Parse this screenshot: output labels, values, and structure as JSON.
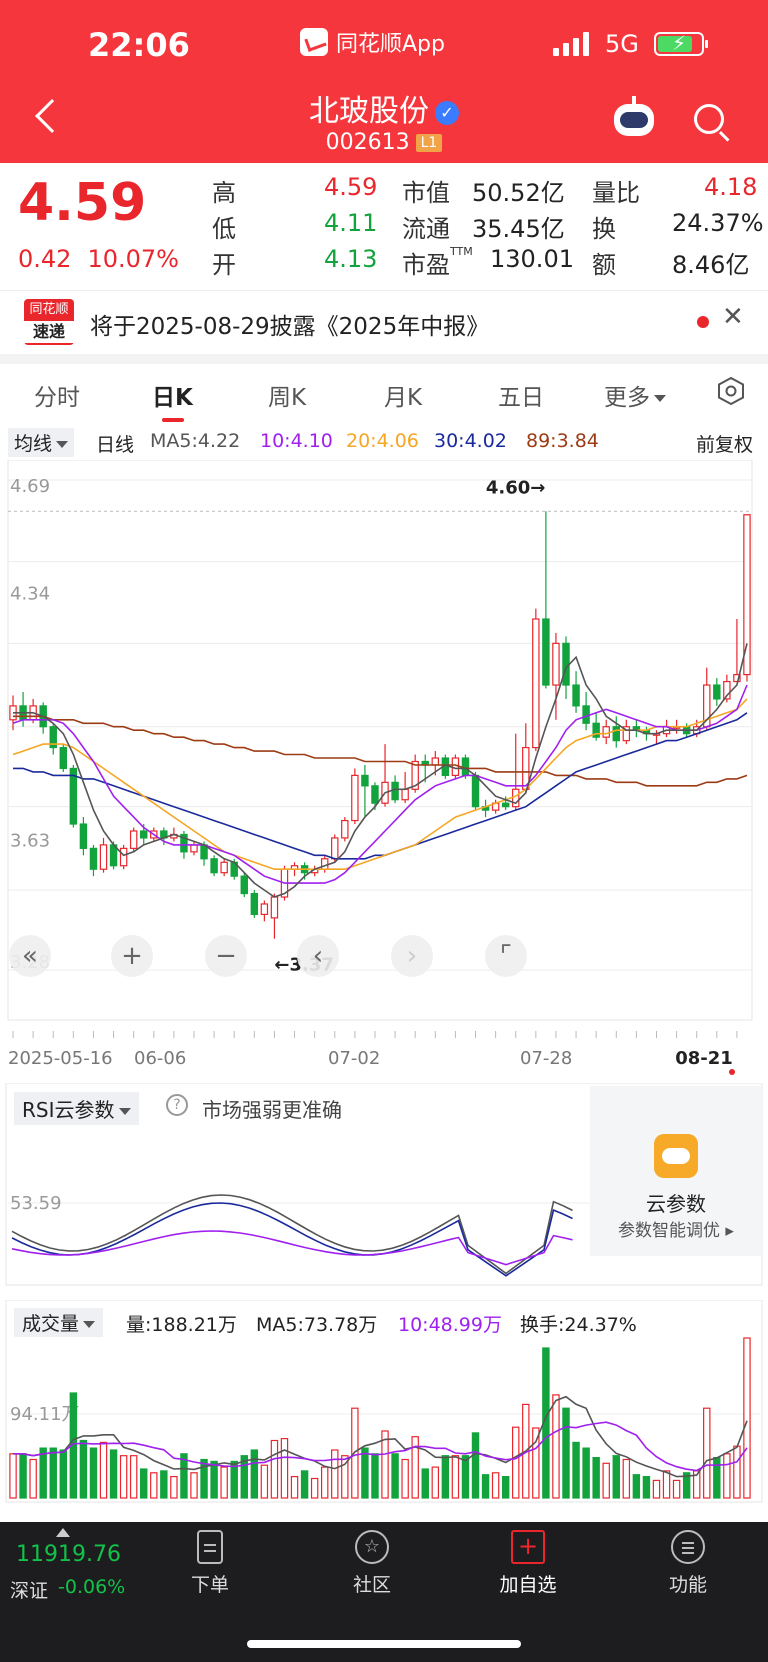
{
  "status": {
    "time": "22:06",
    "app": "同花顺App",
    "network": "5G"
  },
  "header": {
    "name": "北玻股份",
    "verified": "✓",
    "code": "002613",
    "level": "L1"
  },
  "quote": {
    "price": "4.59",
    "change": "0.42",
    "change_pct": "10.07%",
    "rows": [
      {
        "l1": "高",
        "v1": "4.59",
        "l2": "市值",
        "v2": "50.52亿",
        "l3": "量比",
        "v3": "4.18"
      },
      {
        "l1": "低",
        "v1": "4.11",
        "l2": "流通",
        "v2": "35.45亿",
        "l3": "换",
        "v3": "24.37%"
      },
      {
        "l1": "开",
        "v1": "4.13",
        "l2": "市盈",
        "l2_sup": "TTM",
        "v2": "130.01",
        "l3": "额",
        "v3": "8.46亿"
      }
    ]
  },
  "notice": {
    "logo_top": "同花顺",
    "logo_bottom": "速递",
    "text": "将于2025-08-29披露《2025年中报》"
  },
  "tabs": [
    "分时",
    "日K",
    "周K",
    "月K",
    "五日",
    "更多"
  ],
  "legend": {
    "select": "均线",
    "period": "日线",
    "ma5": "MA5:4.22",
    "ma10": "10:4.10",
    "ma20": "20:4.06",
    "ma30": "30:4.02",
    "ma89": "89:3.84",
    "adjust": "前复权"
  },
  "colors": {
    "up": "#e8262c",
    "down": "#12a33d",
    "ma5": "#555555",
    "ma10": "#a020f0",
    "ma20": "#f5a623",
    "ma30": "#1a2a9c",
    "ma89": "#9c3b14"
  },
  "chart": {
    "ytick_labels": [
      "4.69",
      "4.34",
      "3.63",
      "3.28"
    ],
    "max_label": "4.60→",
    "min_label": "←3.37",
    "x_labels": [
      "2025-05-16",
      "06-06",
      "07-02",
      "07-28",
      "08-21"
    ]
  },
  "chart_data": {
    "type": "candlestick",
    "y_ticks": [
      4.69,
      4.34,
      3.63,
      3.28
    ],
    "high_marker": 4.6,
    "low_marker": 3.37,
    "candles": [
      [
        4.0,
        4.04,
        4.07,
        3.97
      ],
      [
        4.04,
        4.0,
        4.08,
        3.98
      ],
      [
        4.0,
        4.04,
        4.06,
        3.99
      ],
      [
        4.04,
        3.98,
        4.05,
        3.96
      ],
      [
        3.98,
        3.92,
        3.99,
        3.9
      ],
      [
        3.92,
        3.86,
        3.93,
        3.85
      ],
      [
        3.86,
        3.7,
        3.87,
        3.69
      ],
      [
        3.7,
        3.63,
        3.72,
        3.61
      ],
      [
        3.63,
        3.57,
        3.64,
        3.55
      ],
      [
        3.57,
        3.64,
        3.66,
        3.56
      ],
      [
        3.64,
        3.58,
        3.65,
        3.57
      ],
      [
        3.58,
        3.63,
        3.64,
        3.57
      ],
      [
        3.63,
        3.68,
        3.69,
        3.62
      ],
      [
        3.68,
        3.66,
        3.7,
        3.64
      ],
      [
        3.66,
        3.68,
        3.69,
        3.65
      ],
      [
        3.68,
        3.66,
        3.69,
        3.64
      ],
      [
        3.66,
        3.67,
        3.69,
        3.65
      ],
      [
        3.67,
        3.62,
        3.68,
        3.6
      ],
      [
        3.62,
        3.64,
        3.65,
        3.61
      ],
      [
        3.64,
        3.6,
        3.65,
        3.58
      ],
      [
        3.6,
        3.56,
        3.61,
        3.55
      ],
      [
        3.56,
        3.59,
        3.6,
        3.55
      ],
      [
        3.59,
        3.55,
        3.6,
        3.54
      ],
      [
        3.55,
        3.5,
        3.56,
        3.49
      ],
      [
        3.5,
        3.44,
        3.51,
        3.43
      ],
      [
        3.44,
        3.47,
        3.48,
        3.42
      ],
      [
        3.43,
        3.49,
        3.5,
        3.37
      ],
      [
        3.49,
        3.57,
        3.58,
        3.48
      ],
      [
        3.57,
        3.58,
        3.59,
        3.55
      ],
      [
        3.58,
        3.56,
        3.59,
        3.54
      ],
      [
        3.56,
        3.57,
        3.58,
        3.55
      ],
      [
        3.57,
        3.6,
        3.61,
        3.56
      ],
      [
        3.6,
        3.66,
        3.67,
        3.59
      ],
      [
        3.66,
        3.71,
        3.72,
        3.65
      ],
      [
        3.71,
        3.84,
        3.86,
        3.7
      ],
      [
        3.84,
        3.81,
        3.87,
        3.72
      ],
      [
        3.81,
        3.76,
        3.82,
        3.74
      ],
      [
        3.76,
        3.82,
        3.93,
        3.75
      ],
      [
        3.82,
        3.77,
        3.84,
        3.76
      ],
      [
        3.77,
        3.8,
        3.85,
        3.76
      ],
      [
        3.8,
        3.88,
        3.9,
        3.79
      ],
      [
        3.88,
        3.87,
        3.9,
        3.82
      ],
      [
        3.87,
        3.89,
        3.91,
        3.84
      ],
      [
        3.89,
        3.84,
        3.9,
        3.83
      ],
      [
        3.84,
        3.89,
        3.9,
        3.83
      ],
      [
        3.89,
        3.84,
        3.9,
        3.83
      ],
      [
        3.84,
        3.75,
        3.85,
        3.74
      ],
      [
        3.75,
        3.74,
        3.77,
        3.72
      ],
      [
        3.74,
        3.76,
        3.77,
        3.73
      ],
      [
        3.76,
        3.75,
        3.78,
        3.74
      ],
      [
        3.75,
        3.8,
        3.96,
        3.74
      ],
      [
        3.8,
        3.92,
        3.99,
        3.79
      ],
      [
        3.92,
        4.29,
        4.32,
        3.91
      ],
      [
        4.29,
        4.1,
        4.6,
        4.09
      ],
      [
        4.1,
        4.22,
        4.25,
        4.0
      ],
      [
        4.22,
        4.1,
        4.24,
        4.06
      ],
      [
        4.1,
        4.04,
        4.14,
        4.02
      ],
      [
        4.04,
        3.99,
        4.08,
        3.97
      ],
      [
        3.99,
        3.95,
        4.02,
        3.94
      ],
      [
        3.95,
        3.98,
        4.0,
        3.93
      ],
      [
        3.98,
        3.94,
        4.01,
        3.92
      ],
      [
        3.94,
        3.98,
        4.0,
        3.93
      ],
      [
        3.98,
        3.97,
        4.0,
        3.95
      ],
      [
        3.97,
        3.96,
        3.98,
        3.94
      ],
      [
        3.96,
        3.96,
        3.97,
        3.93
      ],
      [
        3.96,
        3.98,
        4.0,
        3.95
      ],
      [
        3.98,
        3.98,
        4.0,
        3.96
      ],
      [
        3.98,
        3.96,
        3.99,
        3.95
      ],
      [
        3.96,
        3.98,
        4.0,
        3.95
      ],
      [
        3.98,
        4.1,
        4.15,
        3.97
      ],
      [
        4.1,
        4.06,
        4.12,
        4.04
      ],
      [
        4.06,
        4.11,
        4.13,
        4.05
      ],
      [
        4.11,
        4.13,
        4.29,
        4.11
      ],
      [
        4.13,
        4.59,
        4.59,
        4.11
      ]
    ],
    "ma5": [
      4.02,
      4.02,
      4.02,
      4.01,
      3.99,
      3.96,
      3.9,
      3.82,
      3.74,
      3.68,
      3.64,
      3.61,
      3.62,
      3.64,
      3.65,
      3.66,
      3.67,
      3.66,
      3.65,
      3.64,
      3.62,
      3.6,
      3.59,
      3.56,
      3.53,
      3.51,
      3.49,
      3.5,
      3.52,
      3.55,
      3.57,
      3.58,
      3.59,
      3.62,
      3.68,
      3.72,
      3.75,
      3.79,
      3.8,
      3.8,
      3.81,
      3.83,
      3.85,
      3.87,
      3.86,
      3.86,
      3.84,
      3.81,
      3.78,
      3.77,
      3.76,
      3.79,
      3.89,
      3.98,
      4.06,
      4.15,
      4.18,
      4.1,
      4.06,
      4.01,
      3.99,
      3.97,
      3.97,
      3.96,
      3.96,
      3.97,
      3.97,
      3.97,
      3.97,
      4.0,
      4.03,
      4.07,
      4.1,
      4.22
    ],
    "ma10": [
      3.99,
      4.0,
      4.0,
      4.0,
      4.0,
      3.99,
      3.96,
      3.92,
      3.88,
      3.83,
      3.78,
      3.75,
      3.72,
      3.69,
      3.67,
      3.65,
      3.64,
      3.64,
      3.64,
      3.64,
      3.63,
      3.62,
      3.61,
      3.59,
      3.57,
      3.55,
      3.54,
      3.53,
      3.53,
      3.53,
      3.53,
      3.53,
      3.54,
      3.56,
      3.59,
      3.62,
      3.65,
      3.68,
      3.71,
      3.74,
      3.77,
      3.79,
      3.81,
      3.82,
      3.83,
      3.84,
      3.84,
      3.83,
      3.82,
      3.81,
      3.81,
      3.81,
      3.84,
      3.88,
      3.92,
      3.97,
      4.0,
      4.01,
      4.02,
      4.03,
      4.02,
      4.01,
      4.0,
      3.99,
      3.98,
      3.98,
      3.97,
      3.97,
      3.97,
      3.98,
      3.99,
      4.01,
      4.03,
      4.1
    ],
    "ma20": [
      3.9,
      3.91,
      3.92,
      3.93,
      3.93,
      3.93,
      3.92,
      3.9,
      3.88,
      3.86,
      3.84,
      3.82,
      3.8,
      3.78,
      3.76,
      3.74,
      3.72,
      3.7,
      3.68,
      3.66,
      3.64,
      3.62,
      3.61,
      3.6,
      3.59,
      3.58,
      3.57,
      3.57,
      3.57,
      3.57,
      3.57,
      3.57,
      3.57,
      3.57,
      3.58,
      3.59,
      3.6,
      3.61,
      3.62,
      3.63,
      3.64,
      3.66,
      3.68,
      3.7,
      3.72,
      3.73,
      3.74,
      3.75,
      3.76,
      3.77,
      3.78,
      3.8,
      3.83,
      3.86,
      3.89,
      3.92,
      3.94,
      3.95,
      3.96,
      3.96,
      3.97,
      3.97,
      3.97,
      3.97,
      3.98,
      3.98,
      3.98,
      3.98,
      3.99,
      4.0,
      4.01,
      4.02,
      4.03,
      4.06
    ],
    "ma30": [
      3.86,
      3.86,
      3.85,
      3.85,
      3.84,
      3.84,
      3.84,
      3.83,
      3.83,
      3.82,
      3.81,
      3.8,
      3.79,
      3.78,
      3.77,
      3.76,
      3.75,
      3.74,
      3.73,
      3.72,
      3.71,
      3.7,
      3.69,
      3.68,
      3.67,
      3.66,
      3.65,
      3.64,
      3.63,
      3.62,
      3.61,
      3.61,
      3.6,
      3.6,
      3.6,
      3.6,
      3.61,
      3.61,
      3.62,
      3.63,
      3.64,
      3.65,
      3.66,
      3.67,
      3.68,
      3.69,
      3.7,
      3.71,
      3.72,
      3.73,
      3.74,
      3.75,
      3.77,
      3.79,
      3.81,
      3.83,
      3.85,
      3.86,
      3.87,
      3.88,
      3.89,
      3.9,
      3.91,
      3.92,
      3.93,
      3.94,
      3.94,
      3.95,
      3.96,
      3.97,
      3.98,
      3.99,
      4.0,
      4.02
    ],
    "ma89": [
      4.01,
      4.01,
      4.01,
      4.01,
      4.0,
      4.0,
      4.0,
      3.99,
      3.99,
      3.99,
      3.98,
      3.98,
      3.97,
      3.97,
      3.96,
      3.96,
      3.95,
      3.95,
      3.94,
      3.94,
      3.93,
      3.93,
      3.92,
      3.92,
      3.91,
      3.91,
      3.91,
      3.9,
      3.9,
      3.9,
      3.89,
      3.89,
      3.89,
      3.89,
      3.89,
      3.88,
      3.88,
      3.88,
      3.88,
      3.88,
      3.87,
      3.87,
      3.87,
      3.87,
      3.87,
      3.86,
      3.86,
      3.86,
      3.85,
      3.85,
      3.85,
      3.85,
      3.85,
      3.85,
      3.84,
      3.84,
      3.84,
      3.83,
      3.83,
      3.83,
      3.82,
      3.82,
      3.82,
      3.81,
      3.81,
      3.81,
      3.81,
      3.81,
      3.81,
      3.82,
      3.82,
      3.83,
      3.83,
      3.84
    ]
  },
  "rsi": {
    "select": "RSI云参数",
    "hint": "市场强弱更准确",
    "level_label": "53.59",
    "panel_title": "云参数",
    "panel_sub": "参数智能调优 ▸"
  },
  "volume": {
    "select": "成交量",
    "vol": "量:188.21万",
    "ma5": "MA5:73.78万",
    "ma10": "10:48.99万",
    "turnover": "换手:24.37%",
    "level_label": "94.11万"
  },
  "bottom": {
    "index_value": "11919.76",
    "index_name": "深证",
    "index_change": "-0.06%",
    "nav": [
      "下单",
      "社区",
      "加自选",
      "功能"
    ]
  }
}
